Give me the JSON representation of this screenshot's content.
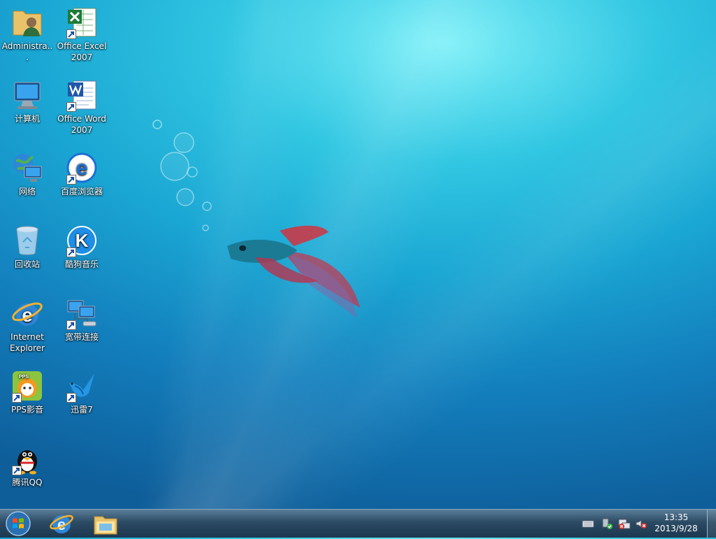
{
  "desktop": {
    "icons": [
      {
        "label": "Administra...",
        "icon": "user-folder-icon"
      },
      {
        "label": "Office Excel 2007",
        "icon": "excel-icon",
        "shortcut": true
      },
      {
        "label": "计算机",
        "icon": "computer-icon"
      },
      {
        "label": "Office Word 2007",
        "icon": "word-icon",
        "shortcut": true
      },
      {
        "label": "网络",
        "icon": "network-icon"
      },
      {
        "label": "百度浏览器",
        "icon": "baidu-browser-icon",
        "shortcut": true
      },
      {
        "label": "回收站",
        "icon": "recycle-bin-icon"
      },
      {
        "label": "酷狗音乐",
        "icon": "kugou-icon",
        "shortcut": true
      },
      {
        "label": "Internet Explorer",
        "icon": "ie-icon"
      },
      {
        "label": "宽带连接",
        "icon": "broadband-icon",
        "shortcut": true
      },
      {
        "label": "PPS影音",
        "icon": "pps-icon",
        "shortcut": true
      },
      {
        "label": "迅雷7",
        "icon": "xunlei-icon",
        "shortcut": true
      },
      {
        "label": "腾讯QQ",
        "icon": "qq-icon",
        "shortcut": true
      }
    ]
  },
  "taskbar": {
    "pinned": [
      "ie-icon",
      "explorer-icon"
    ],
    "tray": [
      "keyboard-icon",
      "safely-remove-icon",
      "network-icon",
      "volume-muted-icon"
    ],
    "clock": {
      "time": "13:35",
      "date": "2013/9/28"
    }
  },
  "colors": {
    "taskbar": "#2b4a64",
    "accent": "#1aa6d3"
  }
}
